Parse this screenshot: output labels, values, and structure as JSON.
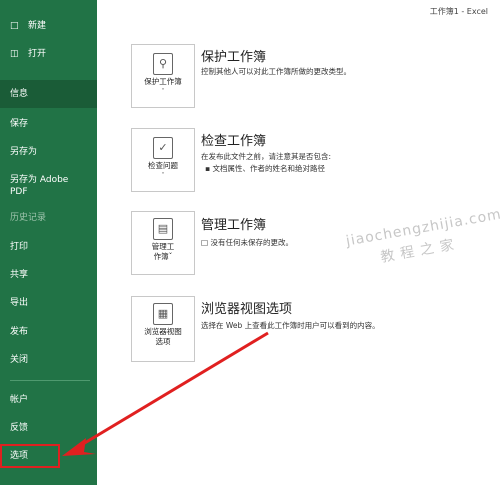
{
  "window_title": "工作簿1 - Excel",
  "sidebar": {
    "items": [
      {
        "label": "新建",
        "icon": "new-doc-icon"
      },
      {
        "label": "打开",
        "icon": "folder-open-icon"
      },
      {
        "label": "信息"
      },
      {
        "label": "保存"
      },
      {
        "label": "另存为"
      },
      {
        "label": "另存为 Adobe"
      },
      {
        "label": "PDF"
      },
      {
        "label": "历史记录"
      },
      {
        "label": "打印"
      },
      {
        "label": "共享"
      },
      {
        "label": "导出"
      },
      {
        "label": "发布"
      },
      {
        "label": "关闭"
      },
      {
        "label": "帐户"
      },
      {
        "label": "反馈"
      },
      {
        "label": "选项"
      }
    ]
  },
  "sections": [
    {
      "card_line1": "保护工作簿",
      "card_line2": "",
      "title": "保护工作簿",
      "desc": "控制其他人可以对此工作簿所做的更改类型。"
    },
    {
      "card_line1": "检查问题",
      "card_line2": "",
      "title": "检查工作簿",
      "desc": "在发布此文件之前，请注意其是否包含:",
      "bullet": "文档属性、作者的姓名和绝对路径"
    },
    {
      "card_line1": "管理工",
      "card_line2": "作簿",
      "title": "管理工作簿",
      "desc": "没有任何未保存的更改。"
    },
    {
      "card_line1": "浏览器视图",
      "card_line2": "选项",
      "title": "浏览器视图选项",
      "desc": "选择在 Web 上查看此工作簿时用户可以看到的内容。"
    }
  ],
  "watermark": {
    "line1": "jiaochengzhijia.com",
    "line2": "教程之家"
  },
  "colors": {
    "sidebar": "#217346",
    "sidebar_active": "#1a5c37",
    "arrow": "#e02020"
  }
}
